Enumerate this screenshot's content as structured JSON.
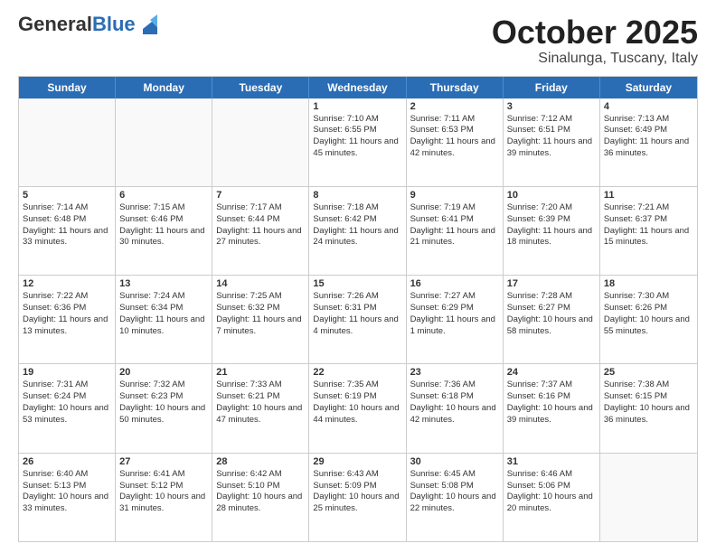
{
  "header": {
    "logo_general": "General",
    "logo_blue": "Blue",
    "month_title": "October 2025",
    "location": "Sinalunga, Tuscany, Italy"
  },
  "days_of_week": [
    "Sunday",
    "Monday",
    "Tuesday",
    "Wednesday",
    "Thursday",
    "Friday",
    "Saturday"
  ],
  "weeks": [
    [
      {
        "day": "",
        "empty": true
      },
      {
        "day": "",
        "empty": true
      },
      {
        "day": "",
        "empty": true
      },
      {
        "day": "1",
        "sunrise": "7:10 AM",
        "sunset": "6:55 PM",
        "daylight": "11 hours and 45 minutes."
      },
      {
        "day": "2",
        "sunrise": "7:11 AM",
        "sunset": "6:53 PM",
        "daylight": "11 hours and 42 minutes."
      },
      {
        "day": "3",
        "sunrise": "7:12 AM",
        "sunset": "6:51 PM",
        "daylight": "11 hours and 39 minutes."
      },
      {
        "day": "4",
        "sunrise": "7:13 AM",
        "sunset": "6:49 PM",
        "daylight": "11 hours and 36 minutes."
      }
    ],
    [
      {
        "day": "5",
        "sunrise": "7:14 AM",
        "sunset": "6:48 PM",
        "daylight": "11 hours and 33 minutes."
      },
      {
        "day": "6",
        "sunrise": "7:15 AM",
        "sunset": "6:46 PM",
        "daylight": "11 hours and 30 minutes."
      },
      {
        "day": "7",
        "sunrise": "7:17 AM",
        "sunset": "6:44 PM",
        "daylight": "11 hours and 27 minutes."
      },
      {
        "day": "8",
        "sunrise": "7:18 AM",
        "sunset": "6:42 PM",
        "daylight": "11 hours and 24 minutes."
      },
      {
        "day": "9",
        "sunrise": "7:19 AM",
        "sunset": "6:41 PM",
        "daylight": "11 hours and 21 minutes."
      },
      {
        "day": "10",
        "sunrise": "7:20 AM",
        "sunset": "6:39 PM",
        "daylight": "11 hours and 18 minutes."
      },
      {
        "day": "11",
        "sunrise": "7:21 AM",
        "sunset": "6:37 PM",
        "daylight": "11 hours and 15 minutes."
      }
    ],
    [
      {
        "day": "12",
        "sunrise": "7:22 AM",
        "sunset": "6:36 PM",
        "daylight": "11 hours and 13 minutes."
      },
      {
        "day": "13",
        "sunrise": "7:24 AM",
        "sunset": "6:34 PM",
        "daylight": "11 hours and 10 minutes."
      },
      {
        "day": "14",
        "sunrise": "7:25 AM",
        "sunset": "6:32 PM",
        "daylight": "11 hours and 7 minutes."
      },
      {
        "day": "15",
        "sunrise": "7:26 AM",
        "sunset": "6:31 PM",
        "daylight": "11 hours and 4 minutes."
      },
      {
        "day": "16",
        "sunrise": "7:27 AM",
        "sunset": "6:29 PM",
        "daylight": "11 hours and 1 minute."
      },
      {
        "day": "17",
        "sunrise": "7:28 AM",
        "sunset": "6:27 PM",
        "daylight": "10 hours and 58 minutes."
      },
      {
        "day": "18",
        "sunrise": "7:30 AM",
        "sunset": "6:26 PM",
        "daylight": "10 hours and 55 minutes."
      }
    ],
    [
      {
        "day": "19",
        "sunrise": "7:31 AM",
        "sunset": "6:24 PM",
        "daylight": "10 hours and 53 minutes."
      },
      {
        "day": "20",
        "sunrise": "7:32 AM",
        "sunset": "6:23 PM",
        "daylight": "10 hours and 50 minutes."
      },
      {
        "day": "21",
        "sunrise": "7:33 AM",
        "sunset": "6:21 PM",
        "daylight": "10 hours and 47 minutes."
      },
      {
        "day": "22",
        "sunrise": "7:35 AM",
        "sunset": "6:19 PM",
        "daylight": "10 hours and 44 minutes."
      },
      {
        "day": "23",
        "sunrise": "7:36 AM",
        "sunset": "6:18 PM",
        "daylight": "10 hours and 42 minutes."
      },
      {
        "day": "24",
        "sunrise": "7:37 AM",
        "sunset": "6:16 PM",
        "daylight": "10 hours and 39 minutes."
      },
      {
        "day": "25",
        "sunrise": "7:38 AM",
        "sunset": "6:15 PM",
        "daylight": "10 hours and 36 minutes."
      }
    ],
    [
      {
        "day": "26",
        "sunrise": "6:40 AM",
        "sunset": "5:13 PM",
        "daylight": "10 hours and 33 minutes."
      },
      {
        "day": "27",
        "sunrise": "6:41 AM",
        "sunset": "5:12 PM",
        "daylight": "10 hours and 31 minutes."
      },
      {
        "day": "28",
        "sunrise": "6:42 AM",
        "sunset": "5:10 PM",
        "daylight": "10 hours and 28 minutes."
      },
      {
        "day": "29",
        "sunrise": "6:43 AM",
        "sunset": "5:09 PM",
        "daylight": "10 hours and 25 minutes."
      },
      {
        "day": "30",
        "sunrise": "6:45 AM",
        "sunset": "5:08 PM",
        "daylight": "10 hours and 22 minutes."
      },
      {
        "day": "31",
        "sunrise": "6:46 AM",
        "sunset": "5:06 PM",
        "daylight": "10 hours and 20 minutes."
      },
      {
        "day": "",
        "empty": true
      }
    ]
  ]
}
